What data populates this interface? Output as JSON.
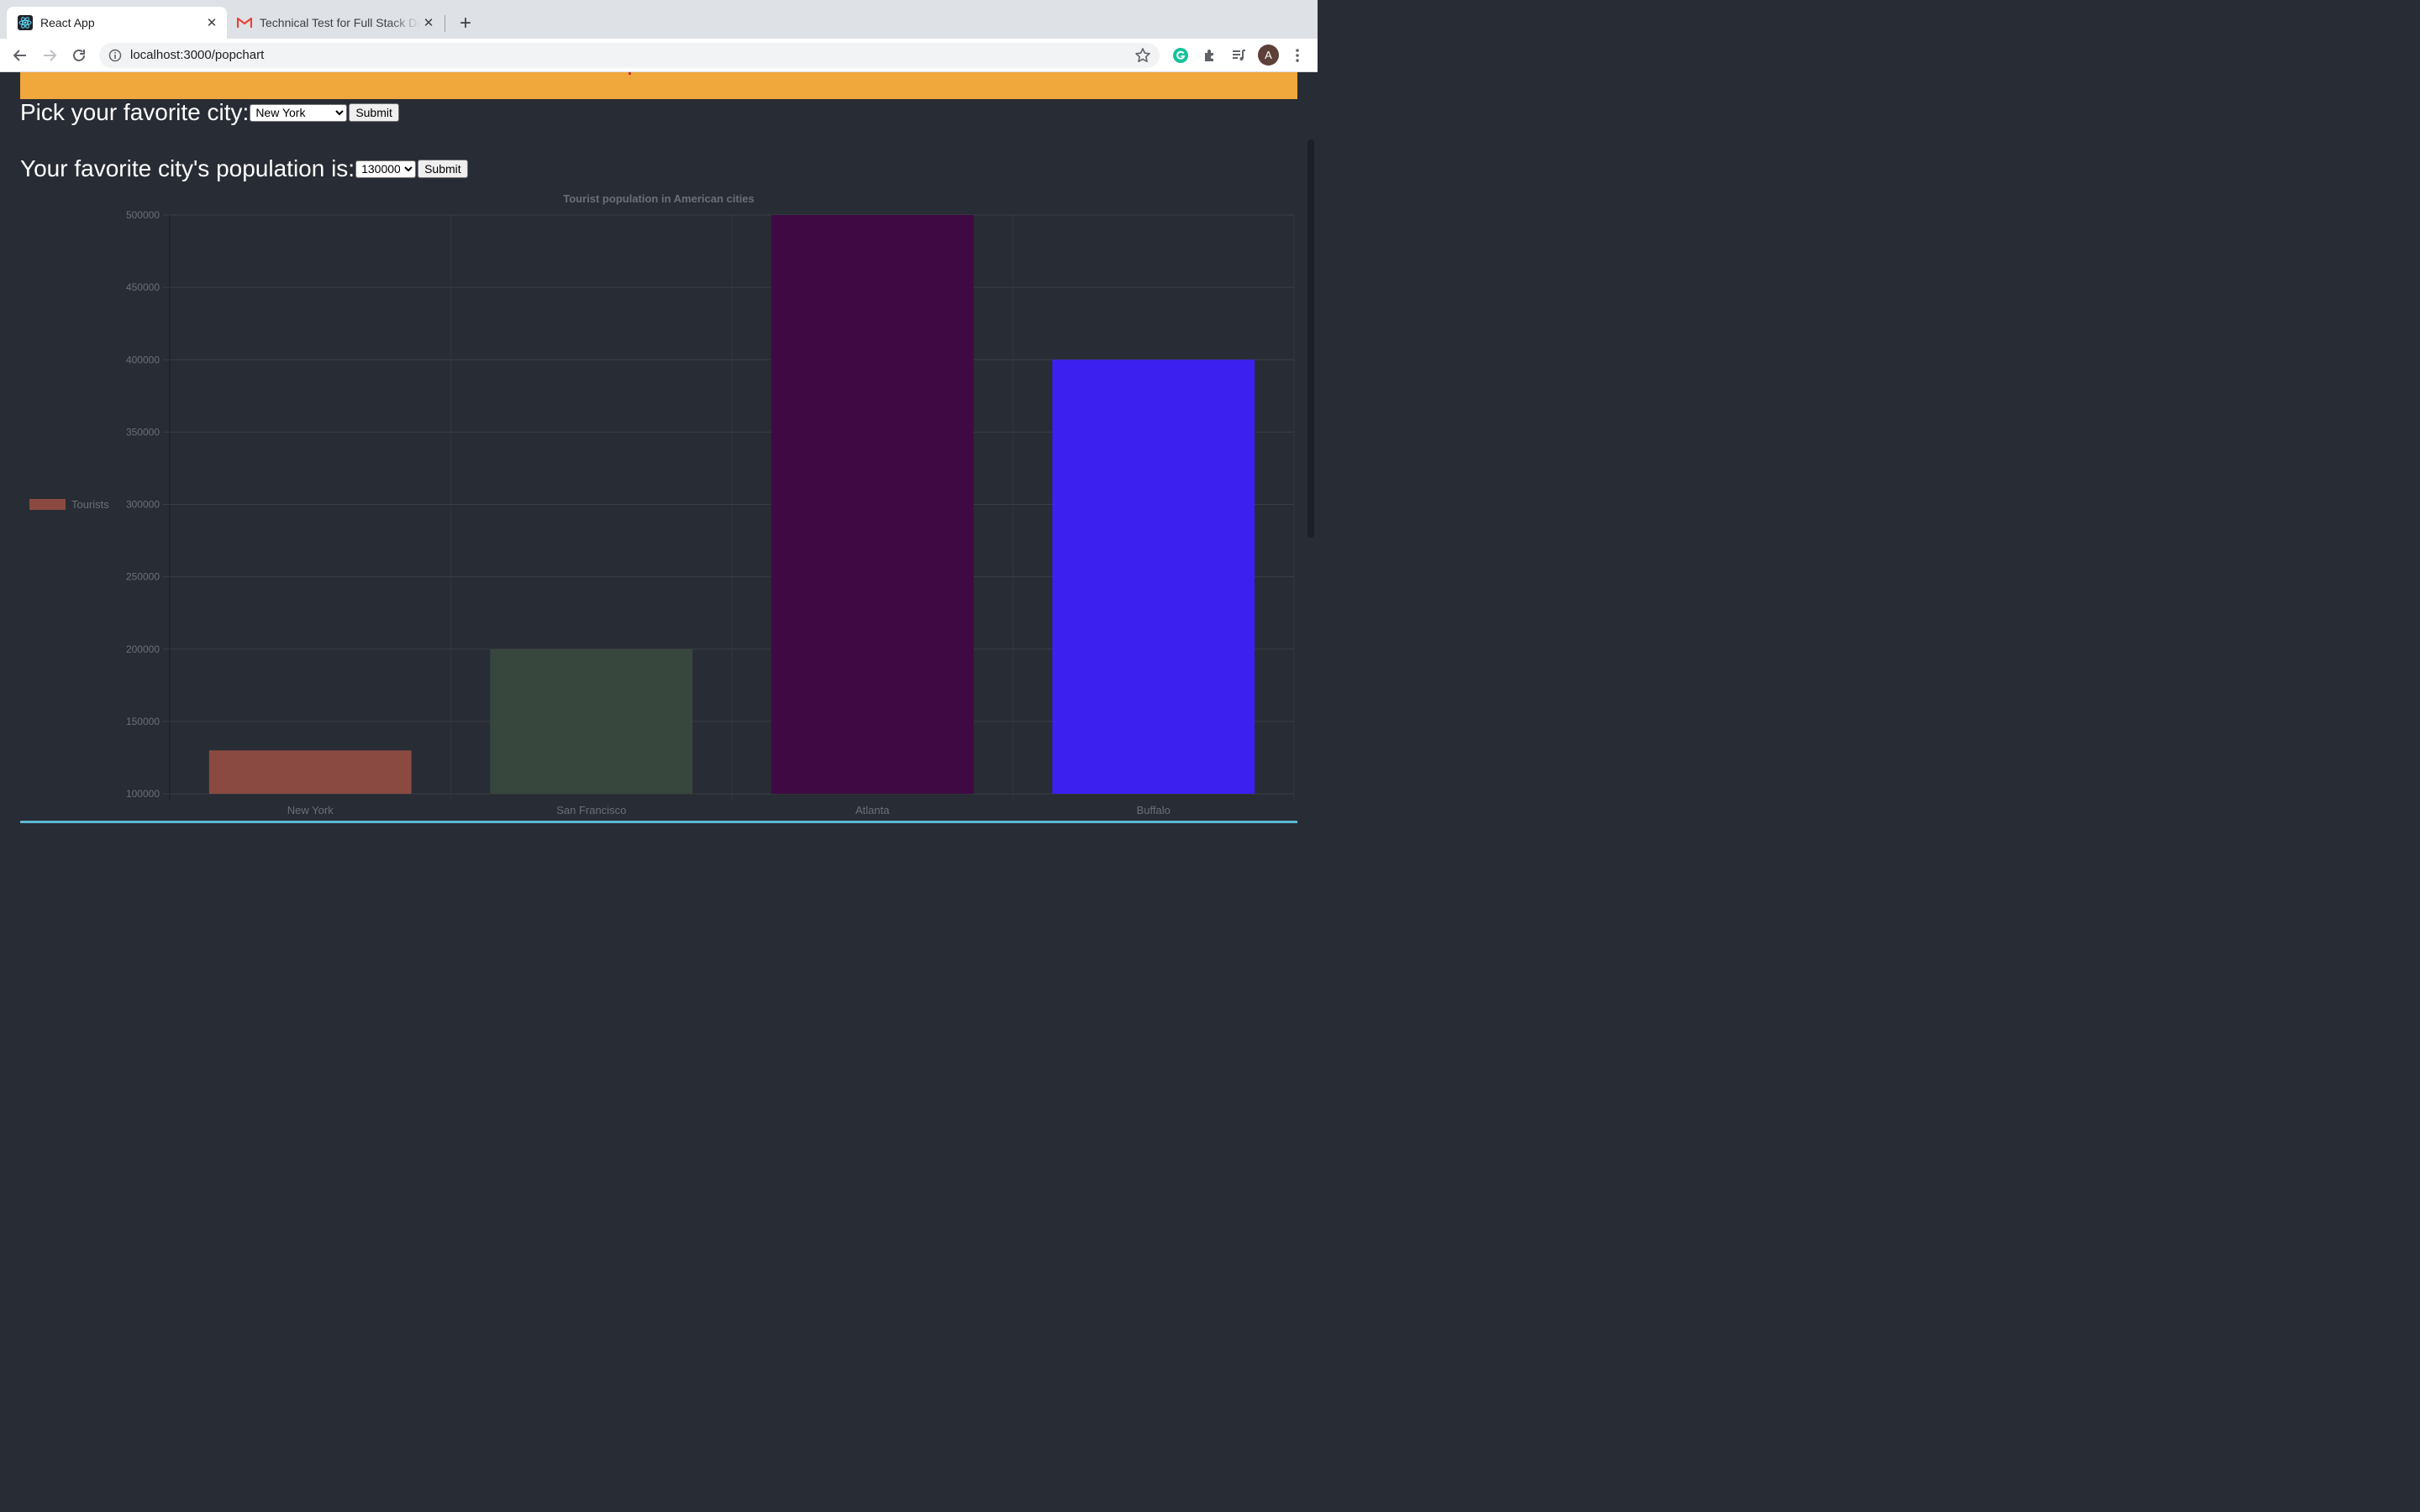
{
  "browser": {
    "tabs": [
      {
        "title": "React App",
        "active": true,
        "icon": "react-icon"
      },
      {
        "title": "Technical Test for Full Stack De",
        "active": false,
        "icon": "gmail-icon"
      }
    ],
    "new_tab_label": "+",
    "url": "localhost:3000/popchart",
    "profile_initial": "A"
  },
  "form": {
    "city_label": "Pick your favorite city:",
    "city_selected": "New York",
    "city_submit": "Submit",
    "population_label": "Your favorite city's population is:",
    "population_selected": "130000",
    "population_submit": "Submit"
  },
  "colors": {
    "page_bg": "#282c34",
    "banner": "#f0a73b"
  },
  "chart_data": {
    "type": "bar",
    "title": "Tourist population in American cities",
    "categories": [
      "New York",
      "San Francisco",
      "Atlanta",
      "Buffalo"
    ],
    "series": [
      {
        "name": "Tourists",
        "values": [
          130000,
          200000,
          500000,
          400000
        ]
      }
    ],
    "bar_colors": [
      "#8a4a42",
      "#37473d",
      "#3f0a43",
      "#3c20f0"
    ],
    "legend_color": "#8a4a42",
    "legend_position": "left",
    "ylim": [
      100000,
      500000
    ],
    "yticks": [
      500000,
      450000,
      400000,
      350000,
      300000,
      250000,
      200000,
      150000,
      100000
    ],
    "grid": true
  }
}
